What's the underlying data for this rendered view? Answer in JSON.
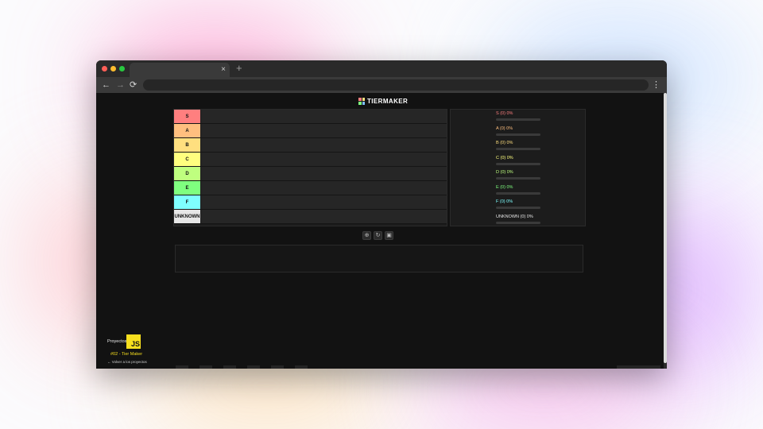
{
  "browser": {
    "tab_close": "×",
    "new_tab": "+",
    "nav": {
      "back": "←",
      "forward": "→",
      "reload": "⟳"
    },
    "address_value": "",
    "menu": "⋮"
  },
  "app": {
    "logo_text": "TIERMAKER",
    "tiers": [
      {
        "label": "S",
        "color": "#ff7f7f"
      },
      {
        "label": "A",
        "color": "#ffbf7f"
      },
      {
        "label": "B",
        "color": "#ffdf7f"
      },
      {
        "label": "C",
        "color": "#ffff7f"
      },
      {
        "label": "D",
        "color": "#bfff7f"
      },
      {
        "label": "E",
        "color": "#7fff7f"
      },
      {
        "label": "F",
        "color": "#7fffff"
      },
      {
        "label": "UNKNOWN",
        "color": "#e6e6e6"
      }
    ],
    "stats": [
      {
        "text": "S (0) 0%",
        "color": "#ff7f7f"
      },
      {
        "text": "A (0) 0%",
        "color": "#ffbf7f"
      },
      {
        "text": "B (0) 0%",
        "color": "#ffdf7f"
      },
      {
        "text": "C (0) 0%",
        "color": "#ffff7f"
      },
      {
        "text": "D (0) 0%",
        "color": "#bfff7f"
      },
      {
        "text": "E (0) 0%",
        "color": "#7fff7f"
      },
      {
        "text": "F (0) 0%",
        "color": "#7fffff"
      },
      {
        "text": "UNKNOWN (0) 0%",
        "color": "#e6e6e6"
      }
    ],
    "controls": [
      {
        "name": "upload-icon",
        "glyph": "⊕"
      },
      {
        "name": "reset-icon",
        "glyph": "↻"
      },
      {
        "name": "save-icon",
        "glyph": "▣"
      }
    ]
  },
  "badge": {
    "label": "Proyectos",
    "js": "JS",
    "title": "#02 - Tier Maker",
    "back_link": "← Volver a los proyectos"
  },
  "colors": {
    "logo_mark": [
      "#ff7f7f",
      "#ffdf7f",
      "#7fff7f",
      "#7fbfff"
    ]
  }
}
